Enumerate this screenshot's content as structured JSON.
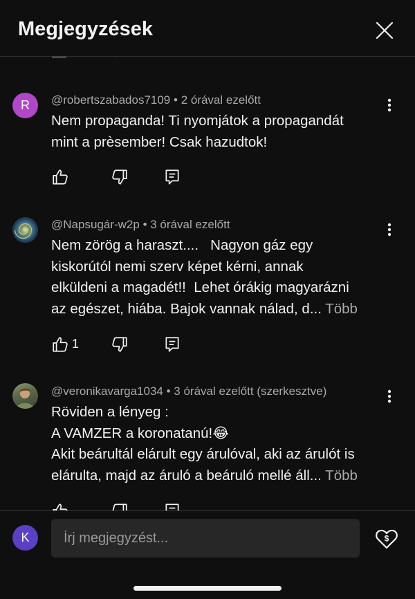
{
  "header": {
    "title": "Megjegyzések"
  },
  "comments": [
    {
      "avatar_letter": "R",
      "avatar_color": "#b047c8",
      "author": "@robertszabados7109",
      "time": "2 órával ezelőtt",
      "lines": [
        "Nem propaganda! Ti nyomjátok a propagandát",
        "mint a prèsember! Csak hazudtok!"
      ],
      "likes": ""
    },
    {
      "avatar_letter": "",
      "author": "@Napsugár-w2p",
      "time": "3 órával ezelőtt",
      "lines": [
        "Nem zörög a haraszt....   Nagyon gáz egy",
        "kiskorútól nemi szerv képet kérni, annak",
        "elküldeni a magadét!!  Lehet órákig magyarázni",
        "az egészet, hiába. Bajok vannak nálad, d..."
      ],
      "more": "Több",
      "likes": "1"
    },
    {
      "avatar_letter": "",
      "author": "@veronikavarga1034",
      "time": "3 órával ezelőtt (szerkesztve)",
      "lines": [
        "Röviden a lényeg :",
        "A VAMZER a koronatanú!😂",
        "Akit beárultál elárult egy árulóval, aki az árulót is",
        "elárulta, majd az áruló a beáruló mellé áll..."
      ],
      "more": "Több",
      "likes": ""
    }
  ],
  "composer": {
    "avatar_letter": "K",
    "placeholder": "Írj megjegyzést..."
  },
  "colors": {
    "background": "#0f0f0f",
    "text": "#f1f1f1",
    "secondary_text": "#aaaaaa",
    "input_bg": "#272727",
    "composer_avatar": "#5c3fc4"
  },
  "icons": [
    "close-icon",
    "more-vert-icon",
    "thumb-up-icon",
    "thumb-down-icon",
    "reply-icon",
    "super-thanks-icon"
  ]
}
